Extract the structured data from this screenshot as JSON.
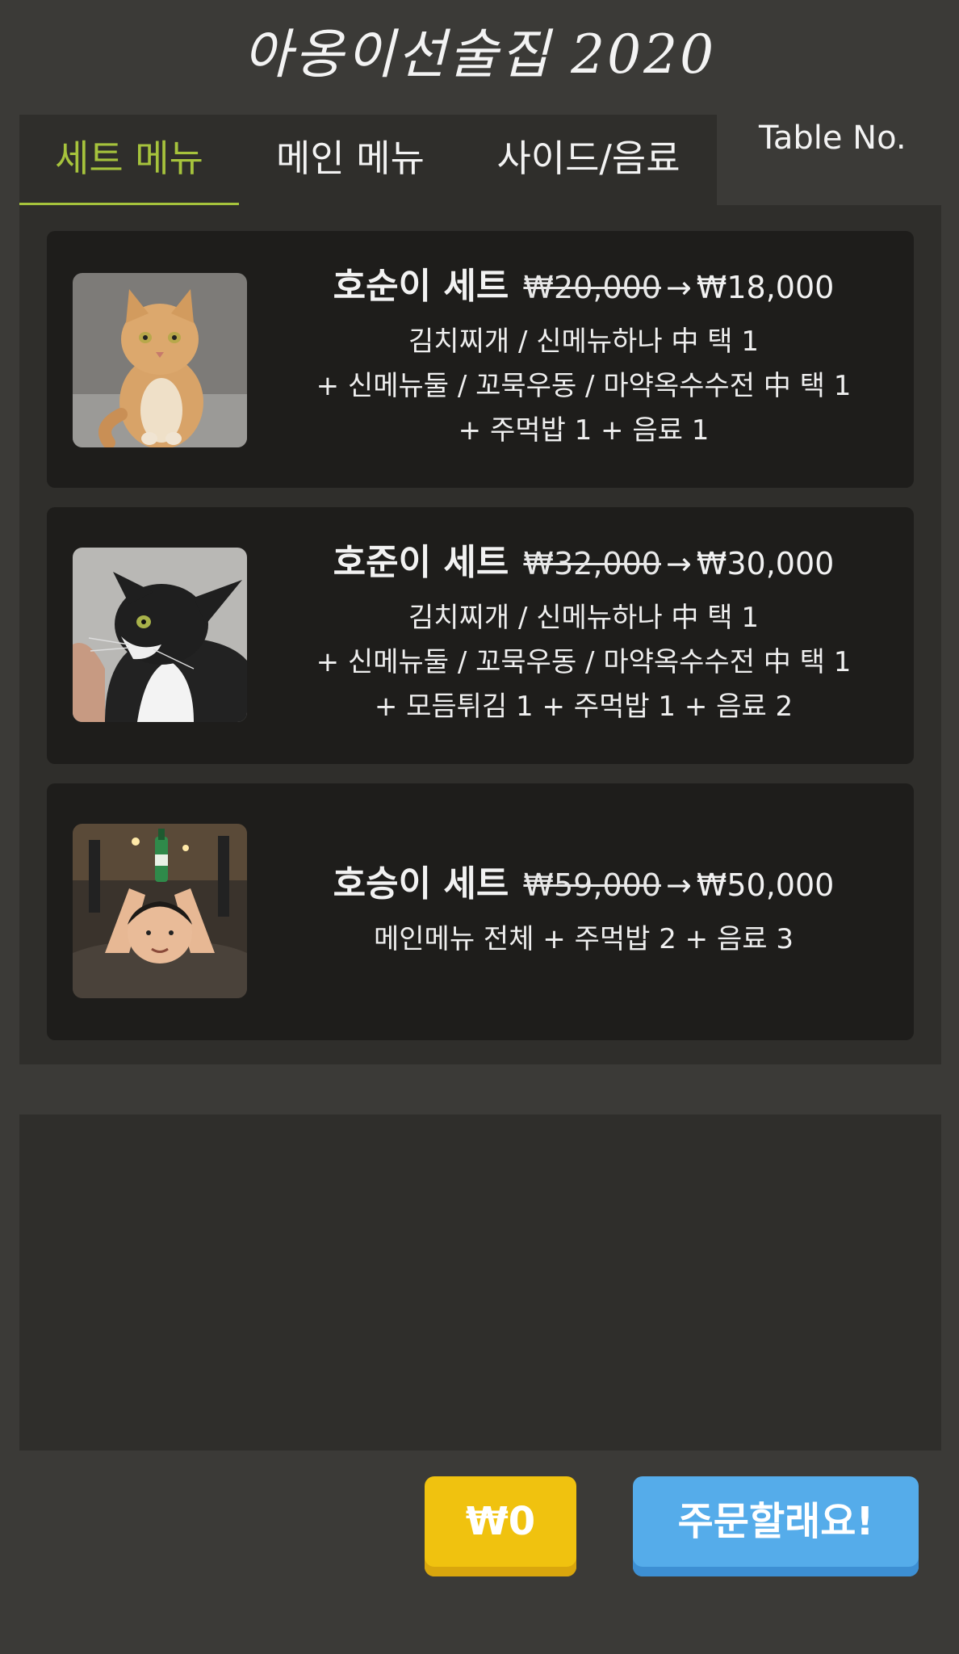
{
  "app": {
    "title": "아옹이선술집 2020"
  },
  "tabs": [
    {
      "label": "세트 메뉴",
      "active": true
    },
    {
      "label": "메인 메뉴",
      "active": false
    },
    {
      "label": "사이드/음료",
      "active": false
    }
  ],
  "table_label": "Table No.",
  "sets": [
    {
      "name": "호순이 세트",
      "old_price": "₩20,000",
      "arrow": "→",
      "new_price": "₩18,000",
      "desc_lines": [
        "김치찌개 / 신메뉴하나 中 택 1",
        "+ 신메뉴둘 / 꼬묵우동 / 마약옥수수전 中 택 1",
        "+ 주먹밥 1 + 음료 1"
      ],
      "image": "orange-tabby-cat-photo"
    },
    {
      "name": "호준이 세트",
      "old_price": "₩32,000",
      "arrow": "→",
      "new_price": "₩30,000",
      "desc_lines": [
        "김치찌개 / 신메뉴하나 中 택 1",
        "+ 신메뉴둘 / 꼬묵우동 / 마약옥수수전 中 택 1",
        "+ 모듬튀김 1 + 주먹밥 1 + 음료 2"
      ],
      "image": "tuxedo-cat-photo"
    },
    {
      "name": "호승이 세트",
      "old_price": "₩59,000",
      "arrow": "→",
      "new_price": "₩50,000",
      "desc_lines": [
        "메인메뉴 전체 + 주먹밥 2 + 음료 3"
      ],
      "image": "man-with-bottle-photo"
    }
  ],
  "footer": {
    "total": "₩0",
    "order_label": "주문할래요!"
  },
  "colors": {
    "accent_green": "#a6c33c",
    "total_yellow": "#f0c20f",
    "order_blue": "#55acea",
    "background": "#3b3a37"
  }
}
